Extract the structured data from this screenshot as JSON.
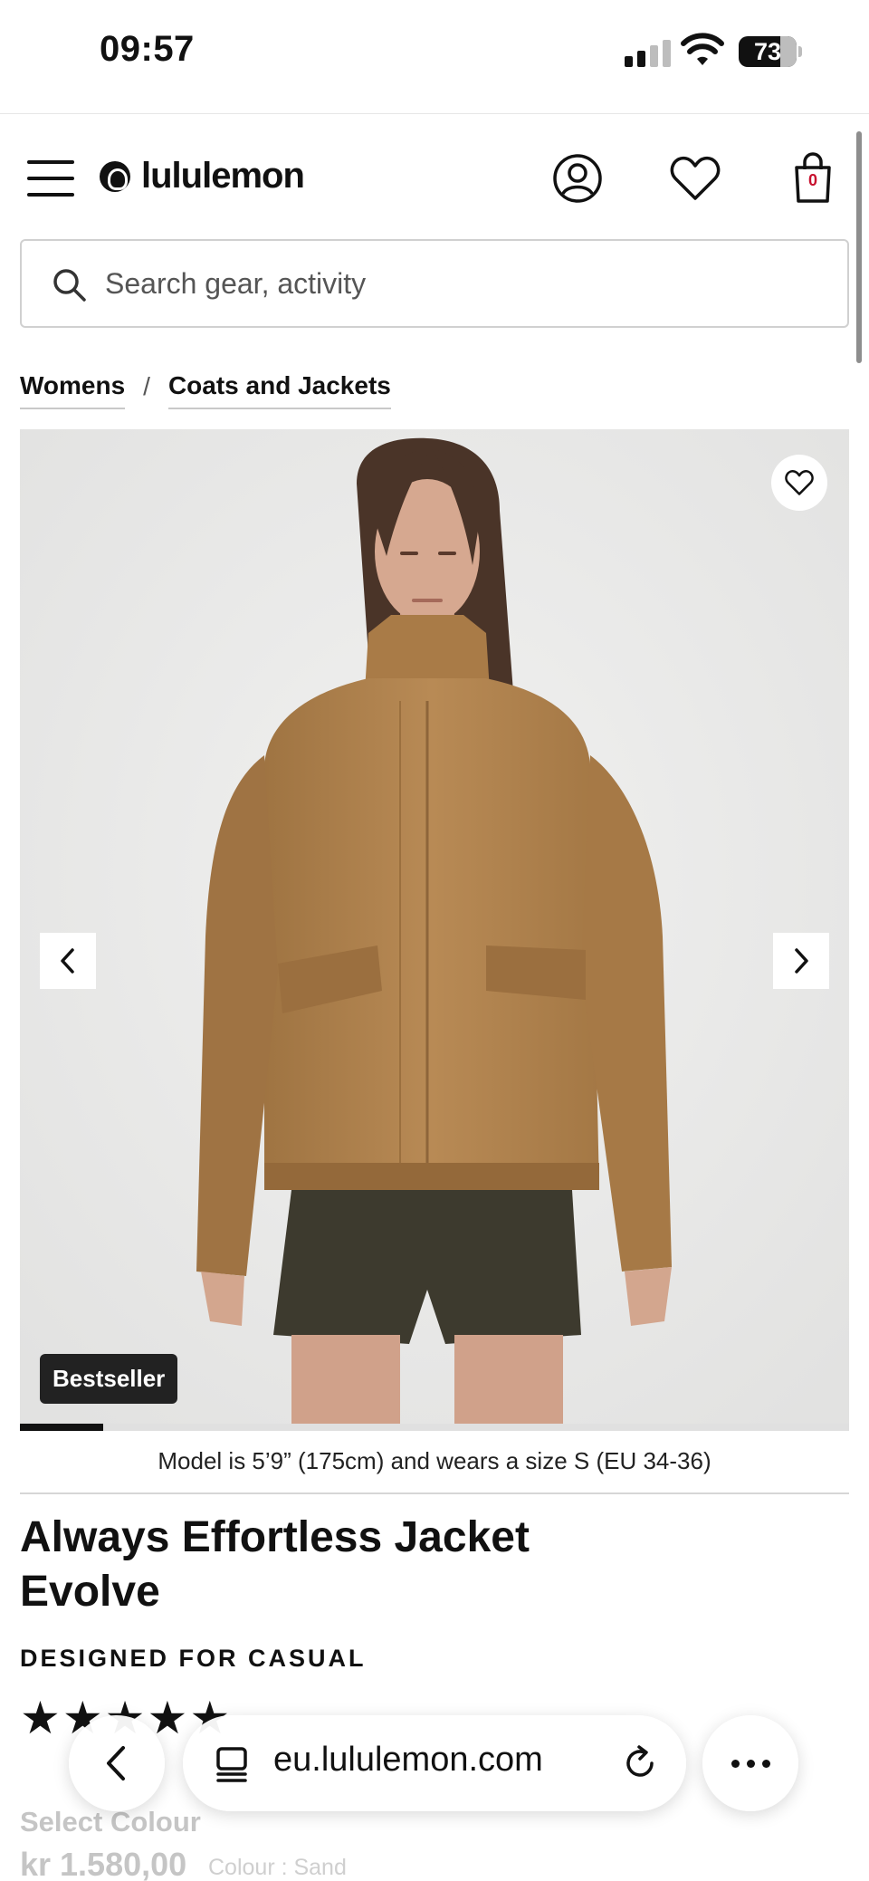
{
  "status_bar": {
    "time": "09:57",
    "battery": "73"
  },
  "header": {
    "brand": "lululemon",
    "bag_count": "0",
    "icons": [
      "menu-icon",
      "lululemon-logo-icon",
      "account-icon",
      "heart-icon",
      "shopping-bag-icon"
    ]
  },
  "search": {
    "placeholder": "Search gear, activity",
    "value": ""
  },
  "breadcrumb": {
    "items": [
      "Womens",
      "Coats and Jackets"
    ],
    "separator": "/"
  },
  "gallery": {
    "badge": "Bestseller",
    "progress": 0.1,
    "caption": "Model is 5’9” (175cm) and wears a size S (EU 34-36)"
  },
  "product": {
    "title": "Always Effortless Jacket Evolve",
    "designed_for": "DESIGNED FOR CASUAL",
    "stars_filled": 5,
    "select_colour_label": "Select Colour",
    "price": "kr 1.580,00",
    "colour_label": "Colour : Sand"
  },
  "browser": {
    "url": "eu.lululemon.com"
  },
  "colors": {
    "accent_red": "#c8102e",
    "jacket": "#b0844f",
    "badge_bg": "#222222"
  }
}
